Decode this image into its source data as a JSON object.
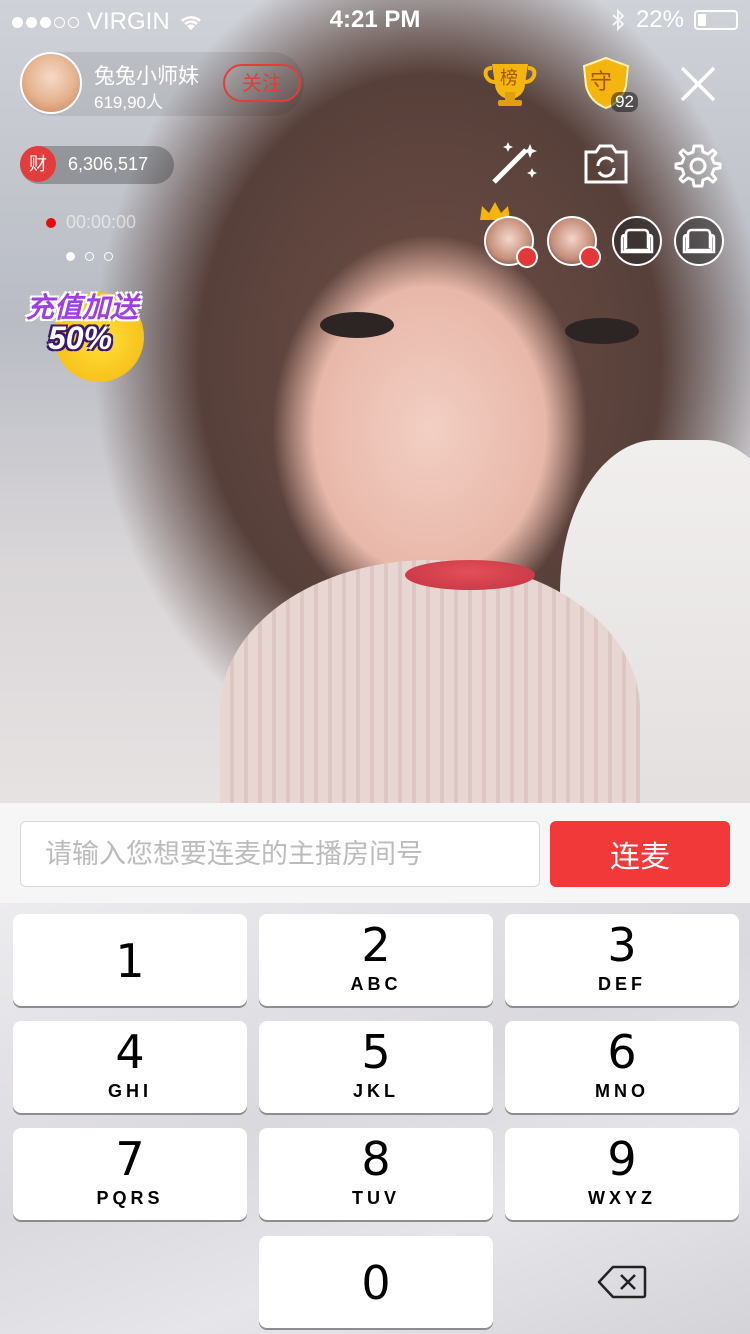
{
  "status_bar": {
    "carrier": "VIRGIN",
    "time": "4:21 PM",
    "battery": "22%",
    "battery_level": 0.22
  },
  "host": {
    "name": "兔兔小师妹",
    "viewers": "619,90人",
    "follow_label": "关注"
  },
  "wealth": {
    "badge": "财",
    "value": "6,306,517"
  },
  "timer": "00:00:00",
  "promo": {
    "line1": "充值加送",
    "line2": "50%"
  },
  "top_icons": {
    "rank_label": "榜",
    "guard_label": "守",
    "guard_count": "92"
  },
  "connect": {
    "placeholder": "请输入您想要连麦的主播房间号",
    "value": "",
    "button": "连麦"
  },
  "keypad": {
    "keys": [
      {
        "digit": "1",
        "letters": ""
      },
      {
        "digit": "2",
        "letters": "ABC"
      },
      {
        "digit": "3",
        "letters": "DEF"
      },
      {
        "digit": "4",
        "letters": "GHI"
      },
      {
        "digit": "5",
        "letters": "JKL"
      },
      {
        "digit": "6",
        "letters": "MNO"
      },
      {
        "digit": "7",
        "letters": "PQRS"
      },
      {
        "digit": "8",
        "letters": "TUV"
      },
      {
        "digit": "9",
        "letters": "WXYZ"
      },
      {
        "digit": "0",
        "letters": ""
      }
    ],
    "delete_icon": "backspace-icon"
  },
  "colors": {
    "accent": "#f2393a",
    "follow": "#e43c3c",
    "gold": "#f5b50f"
  }
}
